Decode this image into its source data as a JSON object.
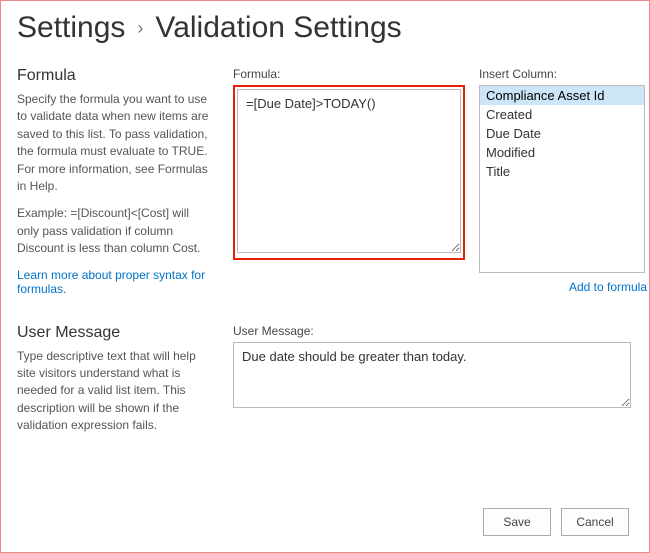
{
  "breadcrumb": {
    "root": "Settings",
    "sep": "›",
    "page": "Validation Settings"
  },
  "formulaSection": {
    "title": "Formula",
    "desc": "Specify the formula you want to use to validate data when new items are saved to this list. To pass validation, the formula must evaluate to TRUE. For more information, see Formulas in Help.",
    "example": "Example: =[Discount]<[Cost] will only pass validation if column Discount is less than column Cost.",
    "learnLink": "Learn more about proper syntax for formulas.",
    "formulaLabel": "Formula:",
    "formulaValue": "=[Due Date]>TODAY()",
    "insertColLabel": "Insert Column:",
    "columns": [
      "Compliance Asset Id",
      "Created",
      "Due Date",
      "Modified",
      "Title"
    ],
    "selectedIndex": 0,
    "addLink": "Add to formula"
  },
  "userMessageSection": {
    "title": "User Message",
    "desc": "Type descriptive text that will help site visitors understand what is needed for a valid list item. This description will be shown if the validation expression fails.",
    "label": "User Message:",
    "value": "Due date should be greater than today."
  },
  "buttons": {
    "save": "Save",
    "cancel": "Cancel"
  }
}
